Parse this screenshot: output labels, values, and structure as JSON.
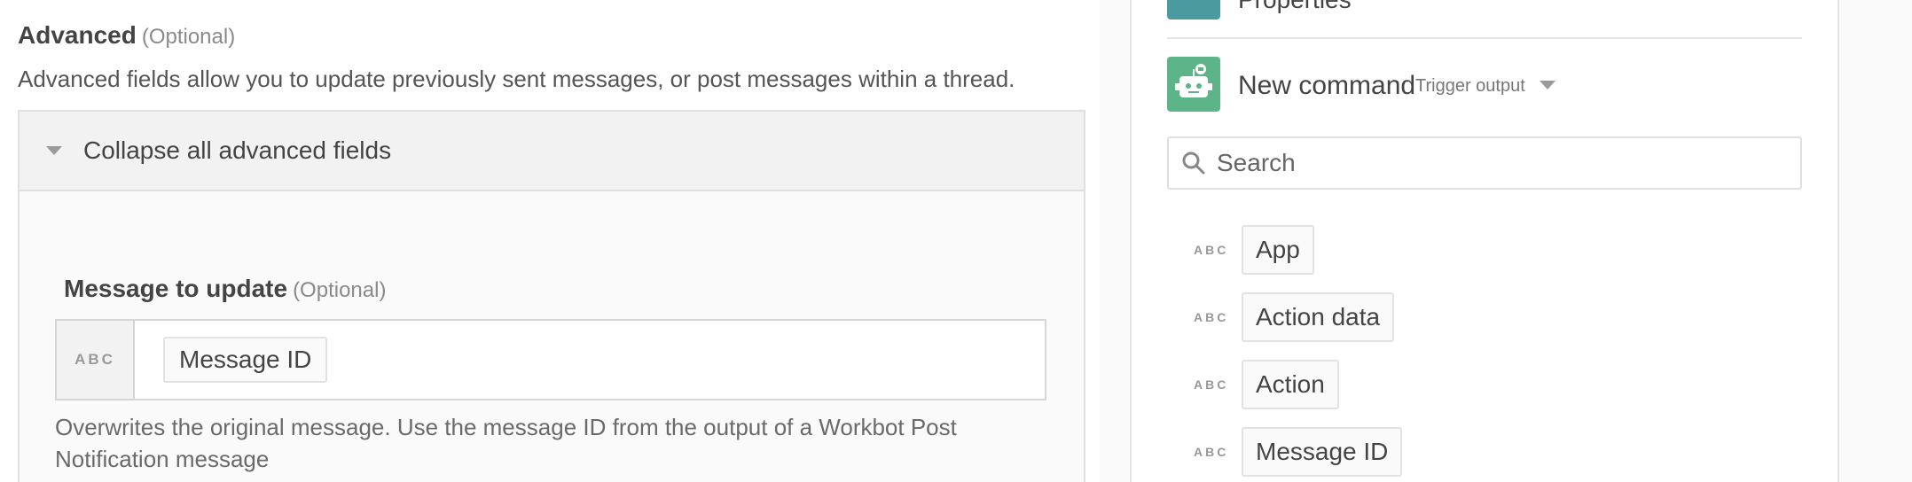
{
  "advanced": {
    "title": "Advanced",
    "optional": "(Optional)",
    "description": "Advanced fields allow you to update previously sent messages, or post messages within a thread.",
    "collapse_label": "Collapse all advanced fields"
  },
  "message_field": {
    "label": "Message to update",
    "optional": "(Optional)",
    "type_badge": "ABC",
    "pill": "Message ID",
    "hint": "Overwrites the original message. Use the message ID from the output of a Workbot Post Notification message"
  },
  "right_panel": {
    "prev_section": "Properties",
    "command_title": "New command",
    "command_sub": "Trigger output",
    "search_placeholder": "Search",
    "outputs": [
      {
        "type": "ABC",
        "label": "App"
      },
      {
        "type": "ABC",
        "label": "Action data"
      },
      {
        "type": "ABC",
        "label": "Action"
      },
      {
        "type": "ABC",
        "label": "Message ID"
      }
    ]
  },
  "colors": {
    "properties_icon": "#4a9aa0",
    "bot_icon": "#5cb488"
  }
}
